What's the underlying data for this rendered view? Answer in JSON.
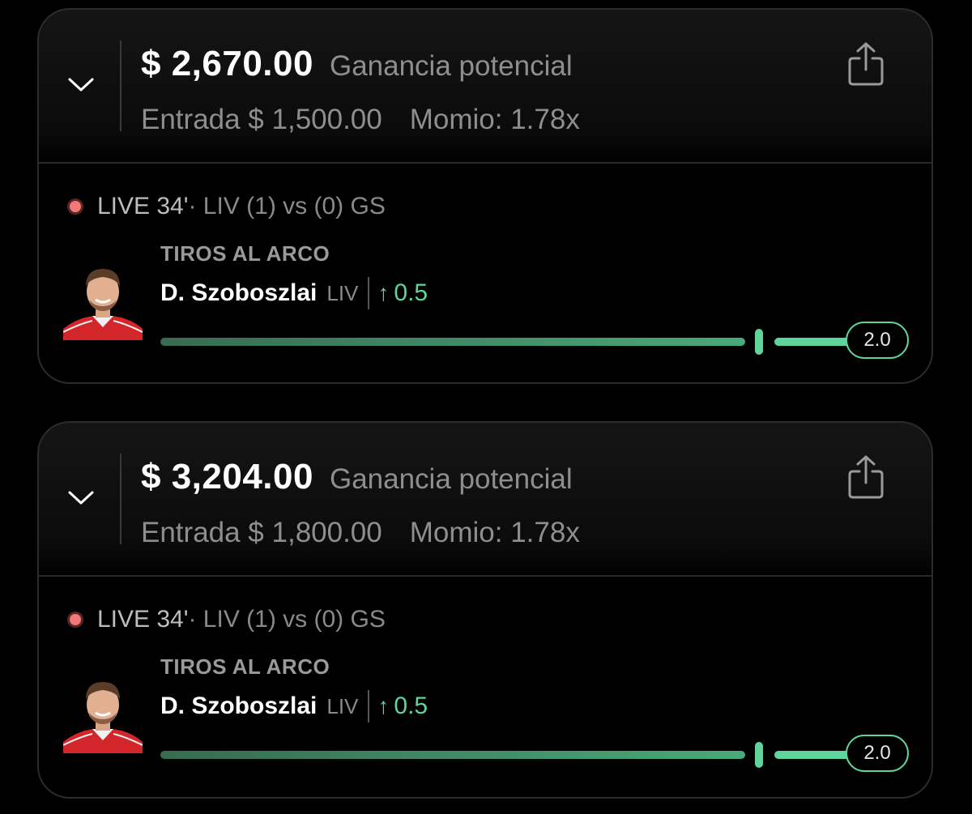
{
  "colors": {
    "background": "#000000",
    "accent_green": "#5fd49b",
    "live_dot": "#f07a7a",
    "muted_text": "#8e8e8e"
  },
  "icons": [
    "chevron-down-icon",
    "share-icon",
    "live-dot-icon",
    "arrow-up-icon",
    "player-avatar"
  ],
  "bets": [
    {
      "payout": "$ 2,670.00",
      "payout_label": "Ganancia potencial",
      "entry": "Entrada $ 1,500.00",
      "odds": "Momio: 1.78x",
      "live": "LIVE 34'",
      "match": " · LIV (1) vs (0) GS",
      "stat": "TIROS AL ARCO",
      "player": "D. Szoboszlai",
      "team": "LIV",
      "line_arrow": "↑",
      "line_value": "0.5",
      "target": "2.0"
    },
    {
      "payout": "$ 3,204.00",
      "payout_label": "Ganancia potencial",
      "entry": "Entrada $ 1,800.00",
      "odds": "Momio: 1.78x",
      "live": "LIVE 34'",
      "match": " · LIV (1) vs (0) GS",
      "stat": "TIROS AL ARCO",
      "player": "D. Szoboszlai",
      "team": "LIV",
      "line_arrow": "↑",
      "line_value": "0.5",
      "target": "2.0"
    }
  ]
}
